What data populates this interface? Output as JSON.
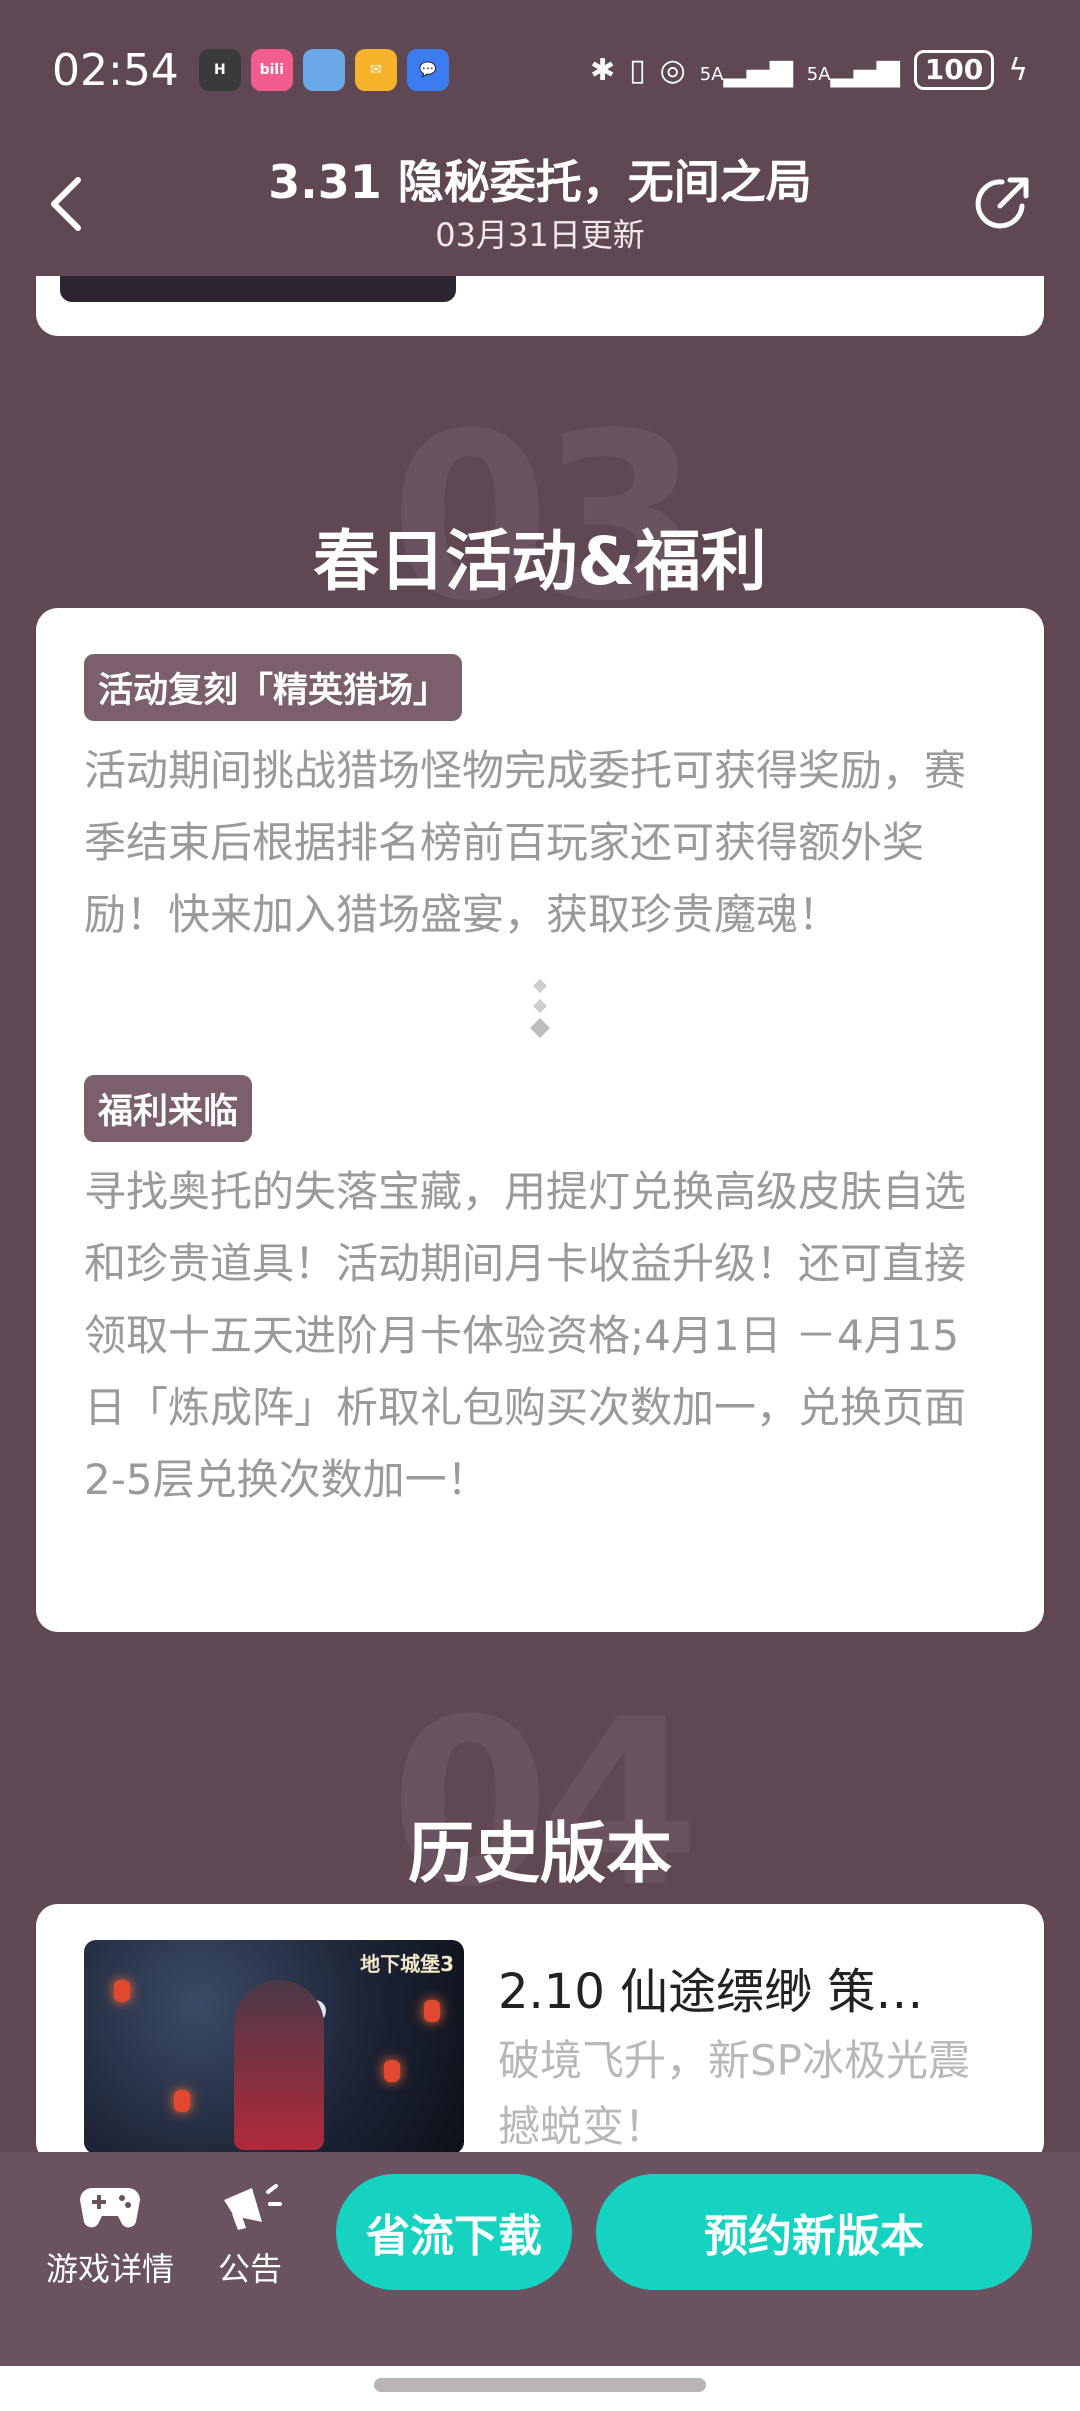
{
  "status_bar": {
    "time": "02:54",
    "notifications": [
      {
        "icon": "app-h-icon",
        "color": "#3a3a3a",
        "text": "H"
      },
      {
        "icon": "bilibili-icon",
        "color": "#f25d8e",
        "text": "bili"
      },
      {
        "icon": "anime-app-icon",
        "color": "#6aa8e8",
        "text": ""
      },
      {
        "icon": "mail-icon",
        "color": "#f6b22a",
        "text": "✉"
      },
      {
        "icon": "message-icon",
        "color": "#3c7cf0",
        "text": "💬"
      }
    ],
    "battery": "100",
    "signal_1": "5A",
    "signal_2": "5A"
  },
  "header": {
    "title": "3.31 隐秘委托，无间之局",
    "subtitle": "03月31日更新"
  },
  "section_03": {
    "number": "03",
    "title": "春日活动&福利",
    "blocks": [
      {
        "tag": "活动复刻「精英猎场」",
        "text": "活动期间挑战猎场怪物完成委托可获得奖励，赛季结束后根据排名榜前百玩家还可获得额外奖励！快来加入猎场盛宴，获取珍贵魔魂！"
      },
      {
        "tag": "福利来临",
        "text": "寻找奥托的失落宝藏，用提灯兑换高级皮肤自选和珍贵道具！活动期间月卡收益升级！还可直接领取十五天进阶月卡体验资格;4月1日 －4月15日「炼成阵」析取礼包购买次数加一，兑换页面2-5层兑换次数加一！"
      }
    ]
  },
  "section_04": {
    "number": "04",
    "title": "历史版本",
    "item": {
      "title": "2.10 仙途缥缈 策…",
      "description": "破境飞升，新SP冰极光震撼蜕变！",
      "thumb_logo": "地下城堡3"
    }
  },
  "bottom_bar": {
    "game_detail": "游戏详情",
    "announcement": "公告",
    "download_btn": "省流下载",
    "reserve_btn": "预约新版本",
    "accent_color": "#16d3c1"
  }
}
